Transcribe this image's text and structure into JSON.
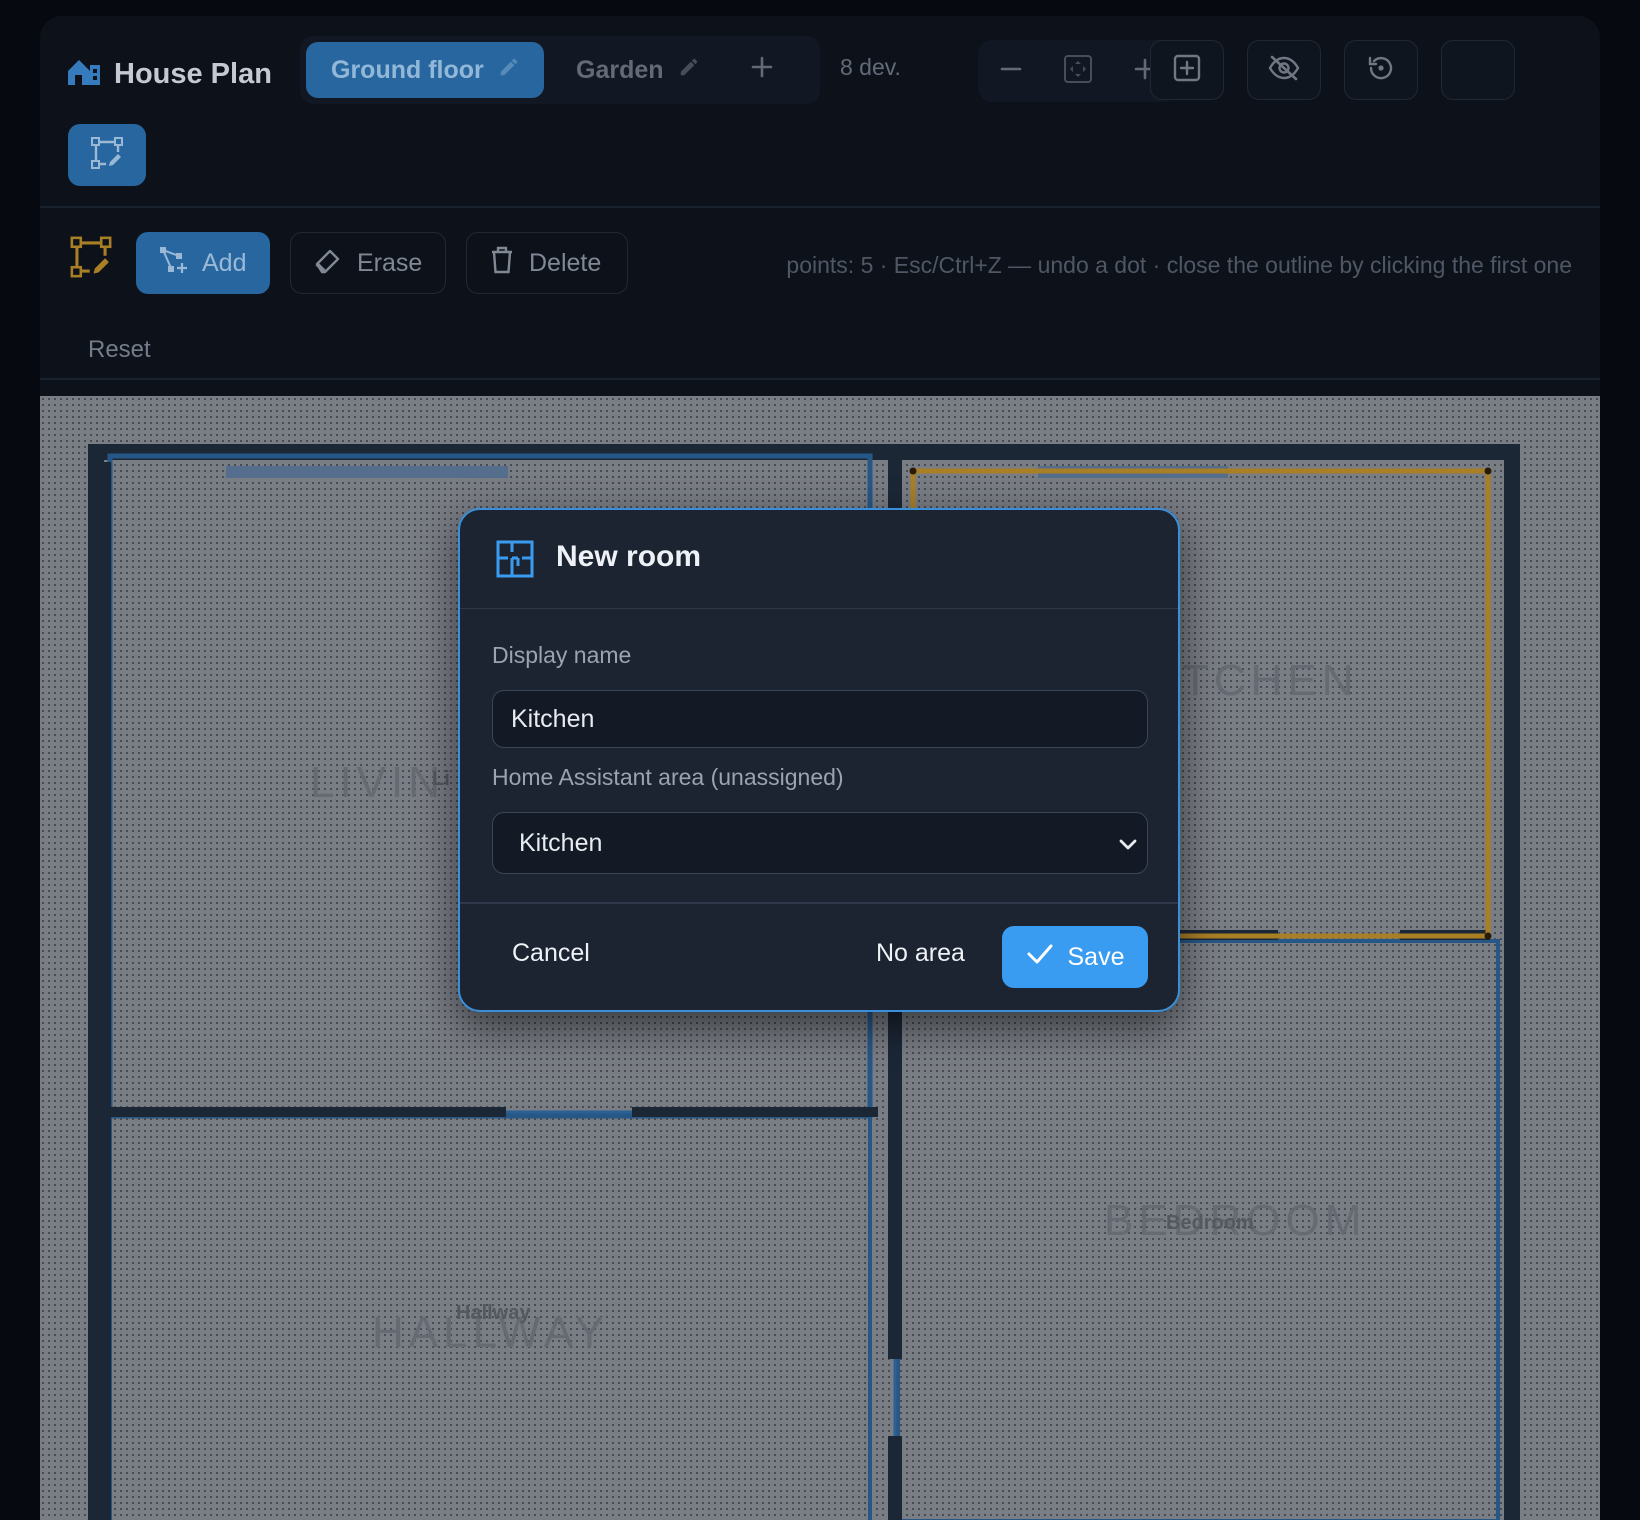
{
  "app": {
    "title": "House Plan",
    "colors": {
      "accent": "#2c6fae",
      "primary": "#3a9cf0",
      "selection": "#b88a2a",
      "walls": "#1f2b3b"
    }
  },
  "floors": {
    "tabs": [
      {
        "label": "Ground floor",
        "active": true,
        "icon": "pencil-icon"
      },
      {
        "label": "Garden",
        "active": false,
        "icon": "pencil-icon"
      }
    ],
    "add_icon": "plus-icon"
  },
  "devices": {
    "count_label": "8 dev."
  },
  "toolbar": {
    "icons": [
      "minus-icon",
      "fit-screen-icon",
      "plus-icon",
      "add-box-icon",
      "eye-off-icon",
      "history-icon"
    ],
    "draw_toggle_icon": "polygon-edit-icon"
  },
  "draw": {
    "add_label": "Add",
    "erase_label": "Erase",
    "delete_label": "Delete",
    "reset_label": "Reset",
    "hint": "points: 5 · Esc/Ctrl+Z — undo a dot · close the outline by clicking the first one"
  },
  "plan": {
    "rooms": [
      {
        "label": "LIVIN",
        "sub": "Li"
      },
      {
        "label": "TCHEN",
        "sub": ""
      },
      {
        "label": "HALLWAY",
        "sub": "Hallway"
      },
      {
        "label": "BEDROOM",
        "sub": "Bedroom"
      }
    ]
  },
  "dialog": {
    "title": "New room",
    "display_name_label": "Display name",
    "display_name_value": "Kitchen",
    "area_label": "Home Assistant area (unassigned)",
    "area_value": "Kitchen",
    "cancel_label": "Cancel",
    "no_area_label": "No area",
    "save_label": "Save"
  }
}
